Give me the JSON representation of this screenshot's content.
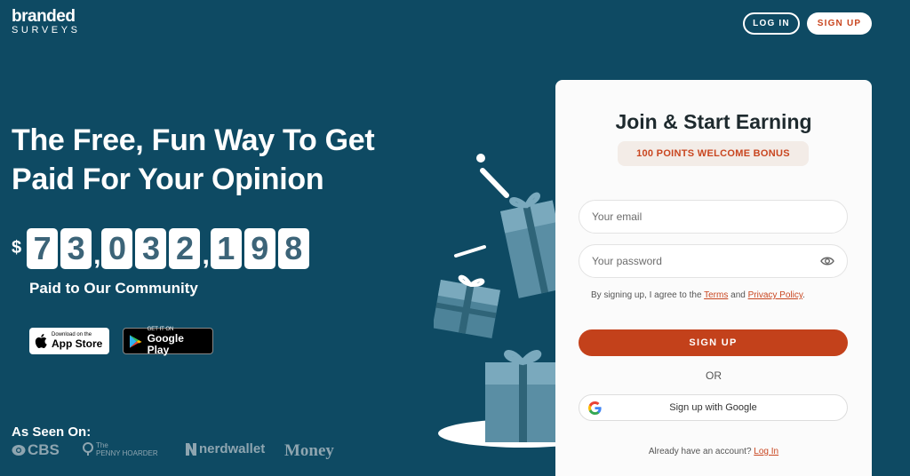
{
  "brand": {
    "logo_top": "branded",
    "logo_bottom": "SURVEYS"
  },
  "nav": {
    "login_label": "LOG IN",
    "signup_label": "SIGN UP"
  },
  "hero": {
    "title": "The Free, Fun Way To Get Paid For Your Opinion",
    "currency": "$",
    "counter_groups": [
      "73",
      "032",
      "198"
    ],
    "counter_label": "Paid to Our Community"
  },
  "stores": {
    "apple_small": "Download on the",
    "apple_big": "App Store",
    "google_small": "GET IT ON",
    "google_big": "Google Play"
  },
  "press": {
    "title": "As Seen On:",
    "cbs": "CBS",
    "penny_top": "The",
    "penny_bottom": "PENNY HOARDER",
    "nerd": "nerdwallet",
    "money": "Money"
  },
  "form": {
    "title": "Join & Start Earning",
    "bonus": "100 POINTS WELCOME BONUS",
    "email_placeholder": "Your email",
    "password_placeholder": "Your password",
    "terms_prefix": "By signing up, I agree to the ",
    "terms_link": "Terms",
    "terms_and": " and ",
    "privacy_link": "Privacy Policy",
    "terms_suffix": ".",
    "signup_button": "SIGN UP",
    "or": "OR",
    "google_button": "Sign up with Google",
    "already_prefix": "Already have an account? ",
    "login_link": "Log In"
  },
  "colors": {
    "background": "#0e4a63",
    "accent": "#c3411b",
    "digit_text": "#3c6478"
  }
}
